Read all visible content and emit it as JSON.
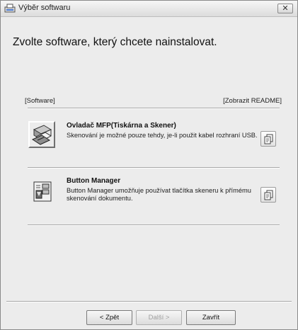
{
  "window": {
    "title": "Výběr softwaru",
    "close_label": "✕"
  },
  "headline": "Zvolte software, který chcete nainstalovat.",
  "section": {
    "left_label": "[Software]",
    "right_label": "[Zobrazit README]"
  },
  "items": [
    {
      "title": "Ovladač MFP(Tiskárna a Skener)",
      "description": "Skenování je možné pouze tehdy, je-li použit kabel rozhraní USB.",
      "icon": "printer-scanner-icon",
      "readme_icon": "document-icon"
    },
    {
      "title": "Button Manager",
      "description": "Button Manager umožňuje používat tlačítka skeneru k přímému skenování dokumentu.",
      "icon": "button-manager-icon",
      "readme_icon": "document-icon"
    }
  ],
  "footer": {
    "back_label": "< Zpět",
    "next_label": "Další >",
    "close_label": "Zavřít"
  }
}
